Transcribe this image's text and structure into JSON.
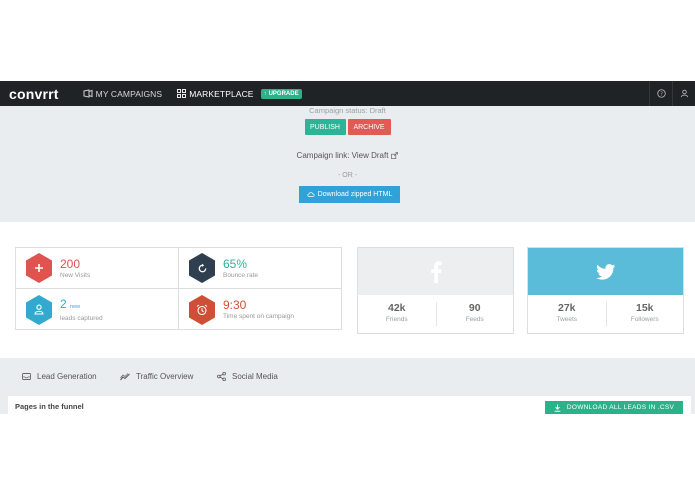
{
  "nav": {
    "logo": "convrrt",
    "my_campaigns": "MY CAMPAIGNS",
    "marketplace": "MARKETPLACE",
    "upgrade": "UPGRADE"
  },
  "campaign": {
    "status": "Campaign status: Draft",
    "publish": "PUBLISH",
    "archive": "ARCHIVE",
    "link_label": "Campaign link: View Draft",
    "or": "- OR -",
    "download_html": "Download zipped HTML"
  },
  "stats": [
    {
      "value": "200",
      "label": "New Visits",
      "icon": "plus-icon",
      "color": "#e0534e"
    },
    {
      "value": "65%",
      "label": "Bounce rate",
      "icon": "refresh-icon",
      "color": "#2f3f4f"
    },
    {
      "value": "2",
      "badge": "new",
      "label": "leads captured",
      "icon": "users-icon",
      "color": "#33a9d0"
    },
    {
      "value": "9:30",
      "label": "Time spent on campaign",
      "icon": "alarm-clock-icon",
      "color": "#d14e36"
    }
  ],
  "facebook": {
    "friends_value": "42k",
    "friends_label": "Friends",
    "feeds_value": "90",
    "feeds_label": "Feeds"
  },
  "twitter": {
    "tweets_value": "27k",
    "tweets_label": "Tweets",
    "followers_value": "15k",
    "followers_label": "Followers"
  },
  "tabs": {
    "lead_generation": "Lead Generation",
    "traffic_overview": "Traffic Overview",
    "social_media": "Social Media"
  },
  "funnel": {
    "title": "Pages in the funnel",
    "download_leads": "DOWNLOAD ALL LEADS IN .CSV"
  },
  "colors": {
    "nav_bg": "#1f2326",
    "accent_green": "#2bb596",
    "accent_red": "#e25a55",
    "accent_blue": "#32a2d6",
    "twitter_blue": "#5bbcd9"
  }
}
